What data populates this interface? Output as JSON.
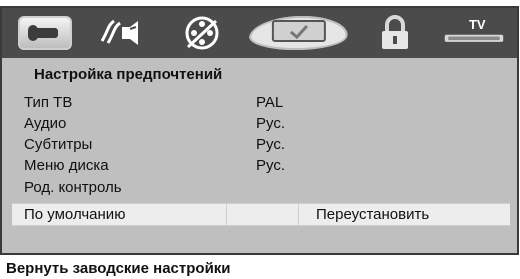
{
  "toolbar": {
    "tv_label": "TV"
  },
  "panel": {
    "title": "Настройка предпочтений",
    "items": [
      {
        "label": "Тип ТВ",
        "value": "PAL"
      },
      {
        "label": "Аудио",
        "value": "Рус."
      },
      {
        "label": "Субтитры",
        "value": "Рус."
      },
      {
        "label": "Меню диска",
        "value": "Рус."
      },
      {
        "label": "Род. контроль",
        "value": ""
      }
    ],
    "selected": {
      "label": "По умолчанию",
      "value": "Переустановить"
    }
  },
  "help_text": "Вернуть заводские настройки"
}
